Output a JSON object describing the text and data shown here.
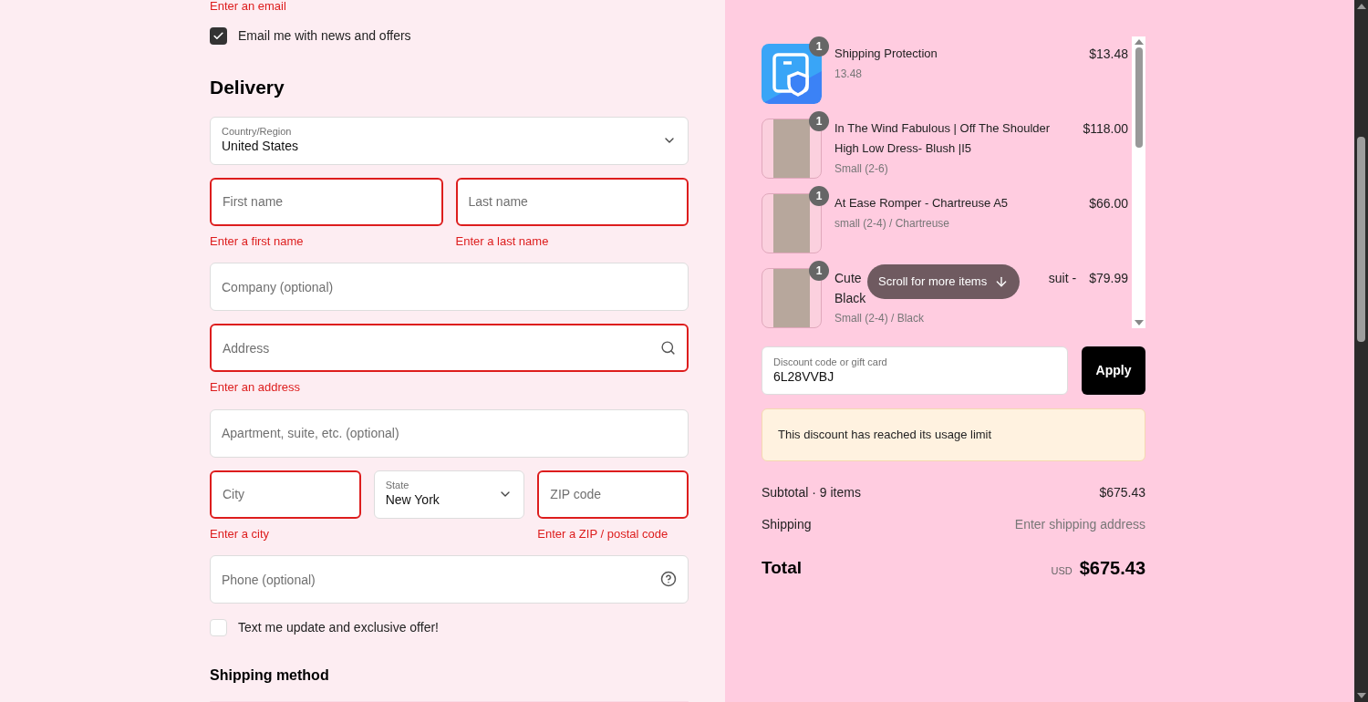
{
  "email_error": "Enter an email",
  "newsletter": {
    "label": "Email me with news and offers",
    "checked": true
  },
  "delivery": {
    "title": "Delivery",
    "rows": [
      [
        {
          "kind": "select",
          "label": "Country/Region",
          "value": "United States"
        }
      ],
      [
        {
          "kind": "input",
          "placeholder": "First name",
          "invalid": true,
          "error": "Enter a first name"
        },
        {
          "kind": "input",
          "placeholder": "Last name",
          "invalid": true,
          "error": "Enter a last name"
        }
      ],
      [
        {
          "kind": "input",
          "placeholder": "Company (optional)",
          "invalid": false
        }
      ],
      [
        {
          "kind": "search_input",
          "placeholder": "Address",
          "invalid": true,
          "error": "Enter an address"
        }
      ],
      [
        {
          "kind": "input",
          "placeholder": "Apartment, suite, etc. (optional)",
          "invalid": false
        }
      ],
      [
        {
          "kind": "input",
          "placeholder": "City",
          "invalid": true,
          "error": "Enter a city"
        },
        {
          "kind": "select",
          "label": "State",
          "value": "New York"
        },
        {
          "kind": "input",
          "placeholder": "ZIP code",
          "invalid": true,
          "error": "Enter a ZIP / postal code"
        }
      ],
      [
        {
          "kind": "help_input",
          "placeholder": "Phone (optional)",
          "invalid": false
        }
      ]
    ]
  },
  "sms": {
    "label": "Text me update and exclusive offer!",
    "checked": false
  },
  "shipping_method": {
    "title": "Shipping method"
  },
  "cart": {
    "items": [
      {
        "kind": "protection",
        "quantity": "1",
        "title": [
          "Shipping Protection"
        ],
        "variant": "13.48",
        "price": "$13.48"
      },
      {
        "kind": "product",
        "quantity": "1",
        "title": [
          "In The Wind Fabulous | Off The Shoulder High Low Dress- Blush |I5"
        ],
        "variant": "Small (2-6)",
        "price": "$118.00"
      },
      {
        "kind": "product",
        "quantity": "1",
        "title": [
          "At Ease Romper - Chartreuse A5"
        ],
        "variant": "small (2-4) / Chartreuse",
        "price": "$66.00"
      },
      {
        "kind": "product",
        "quantity": "1",
        "title": [
          "Cute",
          "suit -",
          "Black"
        ],
        "variant": "Small (2-4) / Black",
        "price": "$79.99"
      }
    ],
    "scroll_hint": "Scroll for more items"
  },
  "discount": {
    "label": "Discount code or gift card",
    "value": "6L28VVBJ",
    "button": "Apply",
    "notice": "This discount has reached its usage limit"
  },
  "summary": [
    {
      "label": "Subtotal · 9 items",
      "value": "$675.43",
      "muted": false
    },
    {
      "label": "Shipping",
      "value": "Enter shipping address",
      "muted": true
    }
  ],
  "total": {
    "label": "Total",
    "currency": "USD",
    "value": "$675.43"
  }
}
